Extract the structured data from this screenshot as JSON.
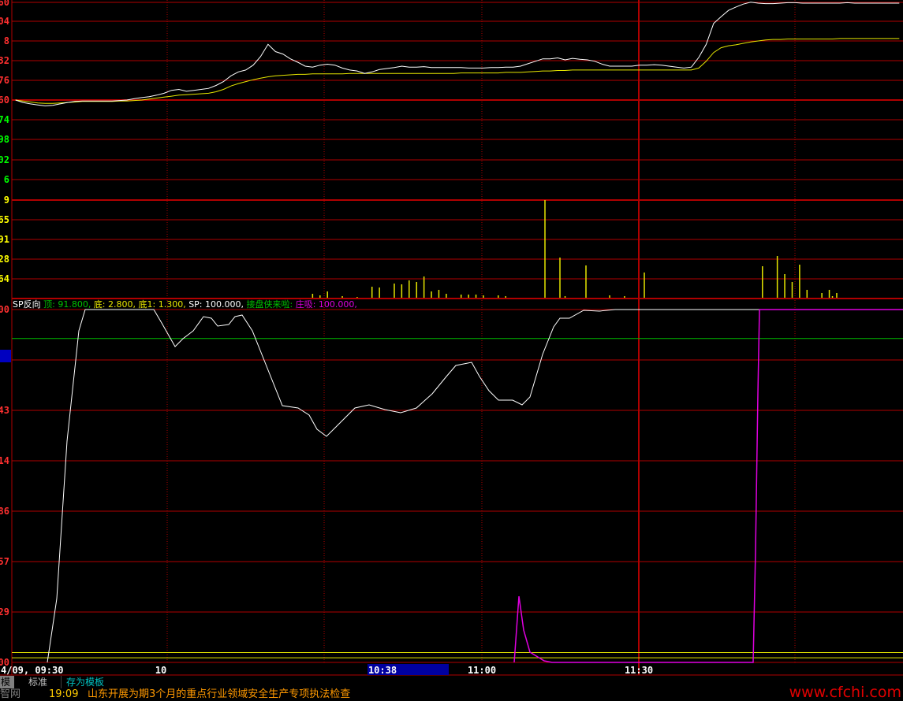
{
  "colors": {
    "grid": "#b00000",
    "price": "#ffffff",
    "avg": "#e6e600",
    "volume": "#e6e600",
    "sp": "#ffffff",
    "green": "#00c000",
    "magenta": "#e000e0",
    "up_label": "#ff3030",
    "down_label": "#00ff00"
  },
  "chart_data": [
    {
      "type": "line",
      "name": "price",
      "y_tick_labels": [
        "60",
        "04",
        "8",
        "32",
        "76",
        "60",
        "74",
        "98",
        "02",
        "6",
        "9"
      ],
      "y_tick_colors": [
        "red",
        "red",
        "red",
        "red",
        "red",
        "red",
        "green",
        "green",
        "green",
        "green",
        "yellow"
      ],
      "x_tick_labels": [
        "4/09, 09:30",
        "10",
        "10:38",
        "11:00",
        "11:30"
      ],
      "series": [
        {
          "values": [
            0.0,
            -0.05,
            -0.08,
            -0.1,
            -0.12,
            -0.11,
            -0.08,
            -0.05,
            -0.03,
            -0.02,
            -0.02,
            -0.02,
            -0.02,
            -0.02,
            -0.01,
            0.0,
            0.03,
            0.05,
            0.07,
            0.1,
            0.14,
            0.2,
            0.22,
            0.18,
            0.2,
            0.22,
            0.24,
            0.3,
            0.38,
            0.5,
            0.58,
            0.62,
            0.72,
            0.9,
            1.15,
            1.0,
            0.95,
            0.85,
            0.78,
            0.7,
            0.68,
            0.72,
            0.74,
            0.72,
            0.66,
            0.62,
            0.6,
            0.55,
            0.58,
            0.63,
            0.65,
            0.67,
            0.7,
            0.68,
            0.68,
            0.69,
            0.67,
            0.67,
            0.67,
            0.67,
            0.67,
            0.66,
            0.66,
            0.66,
            0.67,
            0.67,
            0.68,
            0.68,
            0.7,
            0.75,
            0.8,
            0.85,
            0.85,
            0.87,
            0.83,
            0.86,
            0.84,
            0.83,
            0.8,
            0.74,
            0.7,
            0.7,
            0.7,
            0.7,
            0.72,
            0.72,
            0.73,
            0.72,
            0.7,
            0.68,
            0.66,
            0.68,
            0.88,
            1.15,
            1.58,
            1.72,
            1.85,
            1.92,
            1.98,
            2.02,
            2.0,
            1.99,
            1.99,
            2.0,
            2.01,
            2.01,
            2.0,
            2.0,
            2.0,
            2.0,
            2.0,
            2.0,
            2.01,
            2.0,
            2.0,
            2.0,
            2.0,
            2.0,
            2.0,
            2.0
          ]
        },
        {
          "values": [
            0.0,
            -0.02,
            -0.04,
            -0.06,
            -0.07,
            -0.07,
            -0.06,
            -0.05,
            -0.04,
            -0.03,
            -0.03,
            -0.03,
            -0.03,
            -0.03,
            -0.02,
            -0.02,
            -0.01,
            0.0,
            0.02,
            0.04,
            0.06,
            0.08,
            0.1,
            0.11,
            0.12,
            0.13,
            0.14,
            0.17,
            0.22,
            0.29,
            0.34,
            0.38,
            0.42,
            0.45,
            0.48,
            0.5,
            0.51,
            0.52,
            0.53,
            0.53,
            0.54,
            0.54,
            0.54,
            0.54,
            0.54,
            0.55,
            0.55,
            0.55,
            0.55,
            0.55,
            0.55,
            0.55,
            0.55,
            0.55,
            0.55,
            0.55,
            0.55,
            0.55,
            0.55,
            0.55,
            0.56,
            0.56,
            0.56,
            0.56,
            0.56,
            0.56,
            0.57,
            0.57,
            0.57,
            0.58,
            0.59,
            0.6,
            0.6,
            0.61,
            0.61,
            0.62,
            0.62,
            0.62,
            0.62,
            0.62,
            0.62,
            0.62,
            0.62,
            0.62,
            0.62,
            0.62,
            0.62,
            0.62,
            0.62,
            0.62,
            0.62,
            0.62,
            0.66,
            0.8,
            0.98,
            1.08,
            1.12,
            1.14,
            1.17,
            1.2,
            1.22,
            1.24,
            1.25,
            1.25,
            1.26,
            1.26,
            1.26,
            1.26,
            1.26,
            1.26,
            1.26,
            1.27,
            1.27,
            1.27,
            1.27,
            1.27,
            1.27,
            1.27,
            1.27,
            1.27
          ]
        }
      ]
    },
    {
      "type": "bar",
      "name": "volume",
      "y_tick_labels": [
        "65",
        "91",
        "28",
        "64"
      ],
      "values": [
        0,
        0,
        0,
        0,
        0,
        0,
        0,
        0,
        0,
        0,
        0,
        0,
        0,
        0,
        0,
        0,
        0,
        0,
        0,
        0,
        0,
        0,
        0,
        0,
        0,
        0,
        0,
        0,
        0,
        0,
        0,
        0,
        0,
        0,
        0,
        0,
        0,
        0,
        0,
        0,
        5,
        3,
        8,
        0,
        2,
        0,
        1,
        0,
        14,
        13,
        0,
        18,
        17,
        22,
        20,
        27,
        8,
        10,
        5,
        0,
        4,
        4,
        4,
        3,
        0,
        3,
        2,
        0,
        0,
        0,
        0,
        0,
        0,
        0,
        2,
        0,
        0,
        0,
        0,
        0,
        3,
        0,
        2,
        0,
        0,
        0,
        0,
        0,
        0,
        0,
        0,
        0,
        0,
        0,
        0,
        0,
        0,
        0,
        0,
        0,
        0,
        0,
        0,
        0,
        0,
        0,
        0,
        0,
        0,
        0,
        2,
        0,
        1,
        0,
        0,
        0,
        0,
        0,
        0,
        0
      ]
    },
    {
      "type": "line",
      "name": "indicator",
      "legend": [
        {
          "text": "SP反向",
          "color": "#ffffff"
        },
        {
          "text": "顶: 91.800,",
          "color": "#00c000"
        },
        {
          "text": "底: 2.800,",
          "color": "#e6e600"
        },
        {
          "text": "底1: 1.300,",
          "color": "#e6e600"
        },
        {
          "text": "SP: 100.000,",
          "color": "#ffffff"
        },
        {
          "text": "接盘侠来啦:",
          "color": "#00c000"
        },
        {
          "text": "庄吸: 100.000,",
          "color": "#e000e0"
        }
      ],
      "y_tick_labels": [
        "00",
        "43",
        "14",
        "86",
        "57",
        "29",
        "00"
      ],
      "ylim": [
        0,
        100
      ],
      "levels": {
        "top": 91.8,
        "bottom": 2.8,
        "bottom1": 1.3
      },
      "sp": [
        0,
        0,
        100,
        100,
        100,
        100,
        100,
        100,
        100,
        100,
        100,
        100,
        100,
        100,
        100,
        100,
        100,
        100,
        100,
        100,
        100,
        100,
        100,
        100,
        100,
        100,
        100,
        100,
        100,
        100,
        100,
        100,
        100,
        100,
        100,
        100,
        100,
        100,
        100,
        100,
        100,
        100,
        95,
        85,
        92,
        94,
        97,
        99,
        98,
        96,
        96,
        98,
        96,
        97,
        100,
        99,
        96,
        92,
        88,
        84,
        80,
        76,
        72,
        70,
        69,
        69,
        70,
        66,
        63,
        61,
        60,
        61,
        64,
        66,
        67,
        69,
        68,
        68,
        68,
        67,
        67,
        67,
        68,
        69,
        70,
        74,
        76,
        79,
        80,
        80,
        80,
        79,
        76,
        72,
        70,
        70,
        70,
        69,
        69,
        70,
        76,
        86,
        94,
        96,
        96,
        98,
        99,
        99,
        99,
        99,
        100,
        100,
        100,
        100,
        100,
        100,
        100,
        100,
        100,
        100
      ],
      "zhuangxi_spike": {
        "peak": 25
      }
    }
  ],
  "tabs": {
    "a": "模板",
    "b": "标准",
    "c": "存为模板"
  },
  "news": {
    "source": "智网",
    "time": "19:09",
    "title": "山东开展为期3个月的重点行业领域安全生产专项执法检查"
  },
  "watermark": "www.cfchi.com"
}
